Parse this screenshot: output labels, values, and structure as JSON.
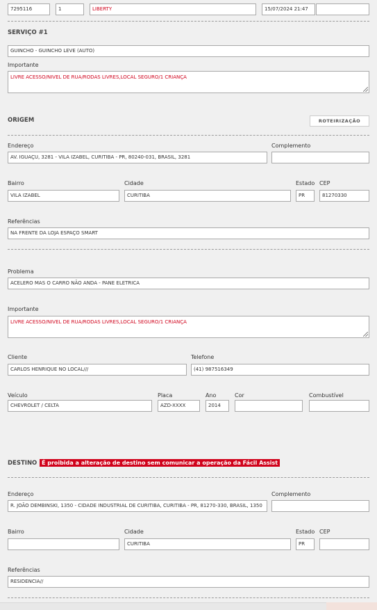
{
  "header": {
    "protocolo": "7295116",
    "seq": "1",
    "cliente": "LIBERTY",
    "data_hora": "15/07/2024 21:47",
    "extra": ""
  },
  "servico": {
    "title": "SERVIÇO #1",
    "tipo": "GUINCHO - GUINCHO LEVE (AUTO)",
    "importante_label": "Importante",
    "importante_value": "LIVRE ACESSO/NIVEL DE RUA/RODAS LIVRES,LOCAL SEGURO/1 CRIANÇA"
  },
  "origem": {
    "title": "ORIGEM",
    "roteirizacao_label": "ROTEIRIZAÇÃO",
    "endereco_label": "Endereço",
    "endereco_value": "AV. IGUAÇU, 3281 - VILA IZABEL, CURITIBA - PR, 80240-031, BRASIL, 3281",
    "complemento_label": "Complemento",
    "complemento_value": "",
    "bairro_label": "Bairro",
    "bairro_value": "VILA IZABEL",
    "cidade_label": "Cidade",
    "cidade_value": "CURITIBA",
    "estado_label": "Estado",
    "estado_value": "PR",
    "cep_label": "CEP",
    "cep_value": "81270330",
    "referencias_label": "Referências",
    "referencias_value": "NA FRENTE DA LOJA ESPAÇO SMART"
  },
  "detalhes": {
    "problema_label": "Problema",
    "problema_value": "ACELERO MAS O CARRO NÃO ANDA - PANE ELETRICA",
    "importante_label": "Importante",
    "importante_value": "LIVRE ACESSO/NIVEL DE RUA/RODAS LIVRES,LOCAL SEGURO/1 CRIANÇA",
    "cliente_label": "Cliente",
    "cliente_value": "CARLOS HENRIQUE NO LOCAL///",
    "telefone_label": "Telefone",
    "telefone_value": "(41) 987516349",
    "veiculo_label": "Veículo",
    "veiculo_value": "CHEVROLET / CELTA",
    "placa_label": "Placa",
    "placa_value": "AZD-XXXX",
    "ano_label": "Ano",
    "ano_value": "2014",
    "cor_label": "Cor",
    "cor_value": "",
    "combustivel_label": "Combustível",
    "combustivel_value": ""
  },
  "destino": {
    "title": "DESTINO",
    "warning": "É proibida a alteração de destino sem comunicar a operação da Fácil Assist",
    "endereco_label": "Endereço",
    "endereco_value": "R. JOÃO DEMBINSKI, 1350 - CIDADE INDUSTRIAL DE CURITIBA, CURITIBA - PR, 81270-330, BRASIL, 1350",
    "complemento_label": "Complemento",
    "complemento_value": "",
    "bairro_label": "Bairro",
    "bairro_value": "",
    "cidade_label": "Cidade",
    "cidade_value": "CURITIBA",
    "estado_label": "Estado",
    "estado_value": "PR",
    "cep_label": "CEP",
    "cep_value": "",
    "referencias_label": "Referências",
    "referencias_value": "RESIDENCIA//"
  },
  "colors": {
    "accent_red": "#d0021b",
    "background": "#f0f0f0",
    "border": "#a9a9a9"
  }
}
